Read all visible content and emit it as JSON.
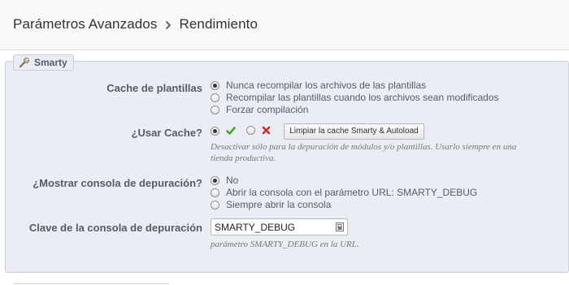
{
  "header": {
    "breadcrumb": [
      "Parámetros Avanzados",
      "Rendimiento"
    ]
  },
  "section": {
    "title": "Smarty",
    "icon": "wrench-icon"
  },
  "cache_plantillas": {
    "label": "Cache de plantillas",
    "options": [
      {
        "label": "Nunca recompilar los archivos de las plantillas",
        "checked": true
      },
      {
        "label": "Recompilar las plantillas cuando los archivos sean modificados",
        "checked": false
      },
      {
        "label": "Forzar compilación",
        "checked": false
      }
    ]
  },
  "usar_cache": {
    "label": "¿Usar Cache?",
    "yes_icon": "checkmark-icon",
    "no_icon": "x-icon",
    "yes_checked": true,
    "clear_button": "Limpiar la cache Smarty & Autoload",
    "help_line1": "Desactivar sólo para la depuración de módulos y/o plantillas. Usarlo siempre en una",
    "help_line2": "tienda productiva."
  },
  "consola": {
    "label": "¿Mostrar consola de depuración?",
    "options": [
      {
        "label": "No",
        "checked": true
      },
      {
        "label": "Abrir la consola con el parámetro URL: SMARTY_DEBUG",
        "checked": false
      },
      {
        "label": "Siempre abrir la consola",
        "checked": false
      }
    ]
  },
  "clave": {
    "label": "Clave de la consola de depuración",
    "value": "SMARTY_DEBUG",
    "help": "parámetro SMARTY_DEBUG en la URL."
  },
  "colors": {
    "check": "#3ea72b",
    "x": "#d22a2a",
    "panel_bg": "#ebedf4"
  }
}
